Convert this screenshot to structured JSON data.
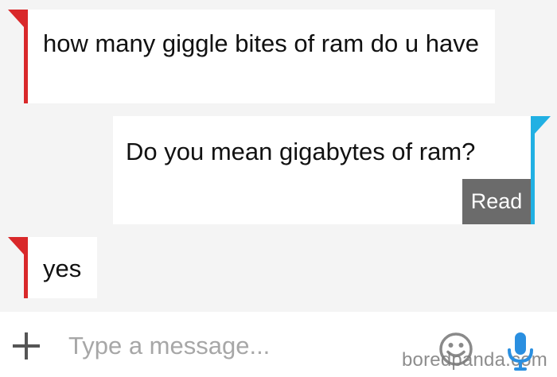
{
  "conversation": {
    "messages": [
      {
        "direction": "incoming",
        "text": "how many giggle bites of ram do u have"
      },
      {
        "direction": "outgoing",
        "text": "Do you mean gigabytes of ram?",
        "status": "Read"
      },
      {
        "direction": "incoming",
        "text": "yes"
      }
    ]
  },
  "composer": {
    "placeholder": "Type a message...",
    "add_icon": "plus-icon",
    "emoji_icon": "smiley-icon",
    "mic_icon": "microphone-icon"
  },
  "watermark": "boredpanda.com",
  "colors": {
    "incoming_accent": "#d9282a",
    "outgoing_accent": "#21b0e3",
    "read_badge": "#6b6b6b",
    "background": "#f4f4f4",
    "bubble": "#ffffff"
  }
}
